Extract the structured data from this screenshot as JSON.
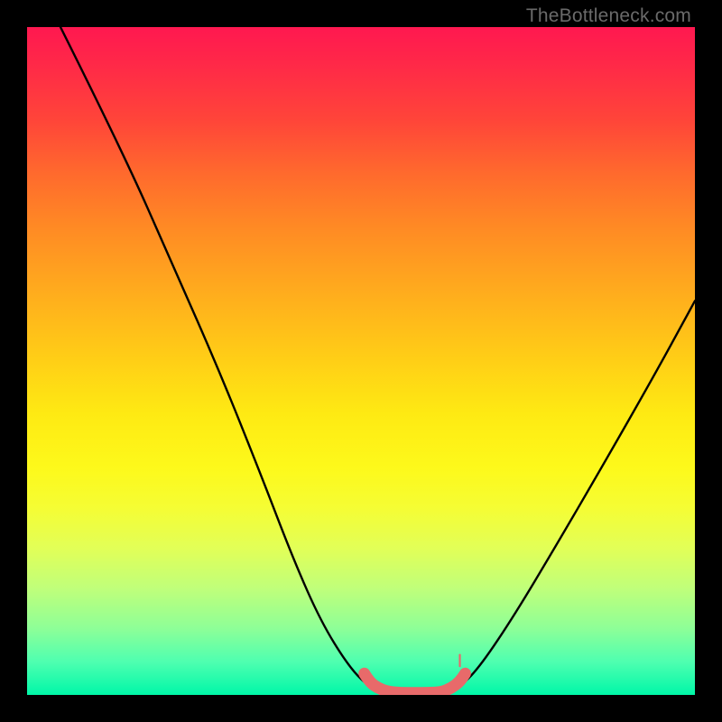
{
  "attribution": "TheBottleneck.com",
  "chart_data": {
    "type": "line",
    "title": "",
    "xlabel": "",
    "ylabel": "",
    "xlim": [
      0,
      100
    ],
    "ylim": [
      0,
      100
    ],
    "grid": false,
    "legend": false,
    "series": [
      {
        "name": "bottleneck-curve",
        "style": "black-thin",
        "points": [
          {
            "x": 5,
            "y": 100
          },
          {
            "x": 14,
            "y": 82
          },
          {
            "x": 22,
            "y": 64
          },
          {
            "x": 29,
            "y": 48
          },
          {
            "x": 35,
            "y": 33
          },
          {
            "x": 40,
            "y": 20
          },
          {
            "x": 44,
            "y": 11
          },
          {
            "x": 48,
            "y": 4.5
          },
          {
            "x": 51,
            "y": 1.3
          },
          {
            "x": 54,
            "y": 0.1
          },
          {
            "x": 58,
            "y": 0.1
          },
          {
            "x": 62,
            "y": 0.15
          },
          {
            "x": 65,
            "y": 1.3
          },
          {
            "x": 68,
            "y": 4.5
          },
          {
            "x": 73,
            "y": 12
          },
          {
            "x": 79,
            "y": 22
          },
          {
            "x": 86,
            "y": 34
          },
          {
            "x": 94,
            "y": 48
          },
          {
            "x": 100,
            "y": 59
          }
        ]
      },
      {
        "name": "optimal-zone-marker",
        "style": "coral-thick",
        "points": [
          {
            "x": 50.5,
            "y": 3.2
          },
          {
            "x": 51.3,
            "y": 1.9
          },
          {
            "x": 52.6,
            "y": 1.0
          },
          {
            "x": 54.0,
            "y": 0.5
          },
          {
            "x": 56.0,
            "y": 0.3
          },
          {
            "x": 58.0,
            "y": 0.3
          },
          {
            "x": 60.0,
            "y": 0.3
          },
          {
            "x": 62.0,
            "y": 0.4
          },
          {
            "x": 63.5,
            "y": 1.0
          },
          {
            "x": 64.8,
            "y": 2.0
          },
          {
            "x": 65.6,
            "y": 3.2
          }
        ]
      },
      {
        "name": "tick-marker",
        "style": "coral-tick",
        "points": [
          {
            "x": 64.8,
            "y": 6.0
          },
          {
            "x": 64.8,
            "y": 4.3
          }
        ]
      }
    ],
    "colors": {
      "curve": "#000000",
      "marker": "#e86a6a",
      "gradient_top": "#ff1850",
      "gradient_bottom": "#00f7a8"
    }
  }
}
